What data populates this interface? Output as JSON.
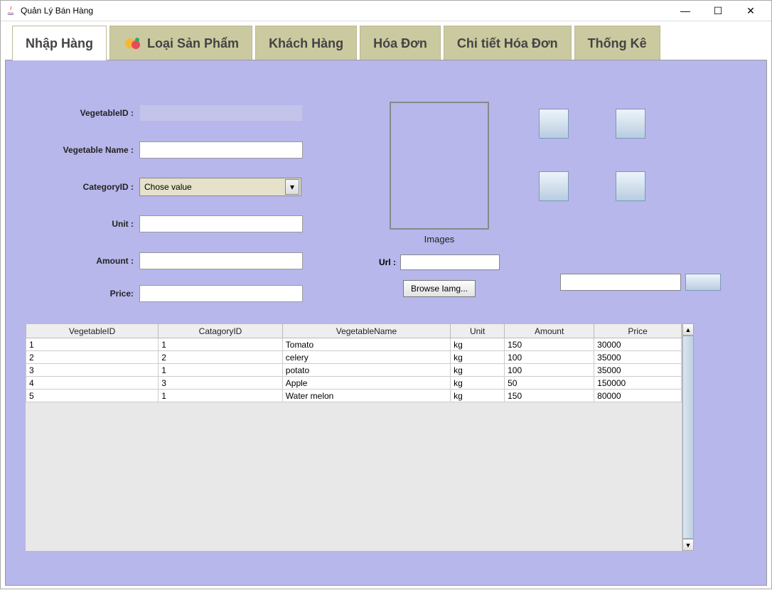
{
  "window": {
    "title": "Quản Lý Bán Hàng"
  },
  "tabs": [
    {
      "label": "Nhập Hàng"
    },
    {
      "label": "Loại Sản Phẩm"
    },
    {
      "label": "Khách Hàng"
    },
    {
      "label": "Hóa Đơn"
    },
    {
      "label": "Chi tiết Hóa Đơn"
    },
    {
      "label": "Thống Kê"
    }
  ],
  "form": {
    "vegetable_id_label": "VegetableID :",
    "vegetable_id_value": "",
    "vegetable_name_label": "Vegetable Name :",
    "vegetable_name_value": "",
    "category_id_label": "CategoryID :",
    "category_select_text": "Chose value",
    "unit_label": "Unit :",
    "unit_value": "",
    "amount_label": "Amount :",
    "amount_value": "",
    "price_label": "Price:",
    "price_value": ""
  },
  "images": {
    "caption": "Images",
    "url_label": "Url :",
    "url_value": "",
    "browse_label": "Browse Iamg..."
  },
  "search": {
    "value": ""
  },
  "table": {
    "headers": [
      "VegetableID",
      "CatagoryID",
      "VegetableName",
      "Unit",
      "Amount",
      "Price"
    ],
    "rows": [
      [
        "1",
        "1",
        "Tomato",
        "kg",
        "150",
        "30000"
      ],
      [
        "2",
        "2",
        "celery",
        "kg",
        "100",
        "35000"
      ],
      [
        "3",
        "1",
        "potato",
        "kg",
        "100",
        "35000"
      ],
      [
        "4",
        "3",
        "Apple",
        "kg",
        "50",
        "150000"
      ],
      [
        "5",
        "1",
        "Water melon",
        "kg",
        "150",
        "80000"
      ]
    ]
  }
}
